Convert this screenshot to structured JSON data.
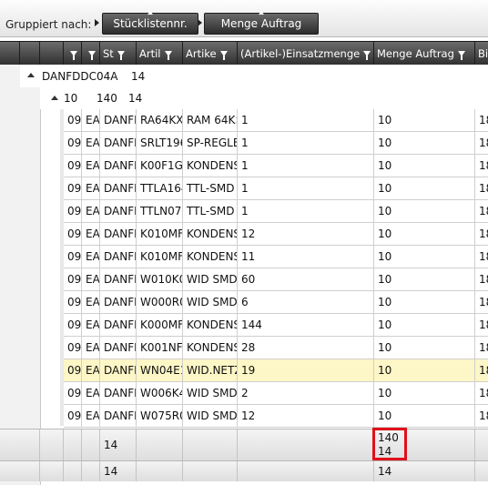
{
  "group_panel": {
    "label": "Gruppiert nach:",
    "chips": [
      "Stücklistennr.",
      "Menge Auftrag"
    ]
  },
  "columns": [
    "",
    "",
    "St",
    "Artil",
    "Artike",
    "(Artikel-)Einsatzmenge",
    "Menge Auftrag",
    "Bi"
  ],
  "group_level1": {
    "name": "DANFDDC04A",
    "count": "14"
  },
  "group_level2": {
    "value1": "10",
    "value2": "140",
    "count": "14"
  },
  "rows": [
    {
      "c1": "09",
      "c2": "EA",
      "c3": "DANFI",
      "c4": "RA64KX:",
      "c5": "RAM 64K>",
      "c6": "1",
      "c7": "10",
      "c8": "18"
    },
    {
      "c1": "09",
      "c2": "EA",
      "c3": "DANFI",
      "c4": "SRLT196",
      "c5": "SP-REGLEI",
      "c6": "1",
      "c7": "10",
      "c8": "18"
    },
    {
      "c1": "09",
      "c2": "EA",
      "c3": "DANFI",
      "c4": "K00F1G(",
      "c5": "KONDENS",
      "c6": "1",
      "c7": "10",
      "c8": "18"
    },
    {
      "c1": "09",
      "c2": "EA",
      "c3": "DANFI",
      "c4": "TTLA164",
      "c5": "TTL-SMD",
      "c6": "1",
      "c7": "10",
      "c8": "18"
    },
    {
      "c1": "09",
      "c2": "EA",
      "c3": "DANFI",
      "c4": "TTLN07S",
      "c5": "TTL-SMD",
      "c6": "1",
      "c7": "10",
      "c8": "18"
    },
    {
      "c1": "09",
      "c2": "EA",
      "c3": "DANFI",
      "c4": "K010MF",
      "c5": "KONDENS",
      "c6": "12",
      "c7": "10",
      "c8": "18"
    },
    {
      "c1": "09",
      "c2": "EA",
      "c3": "DANFI",
      "c4": "K010MF",
      "c5": "KONDENS",
      "c6": "11",
      "c7": "10",
      "c8": "18"
    },
    {
      "c1": "09",
      "c2": "EA",
      "c3": "DANFI",
      "c4": "W010K0",
      "c5": "WID SMD",
      "c6": "60",
      "c7": "10",
      "c8": "18"
    },
    {
      "c1": "09",
      "c2": "EA",
      "c3": "DANFI",
      "c4": "W000R0",
      "c5": "WID SMD",
      "c6": "6",
      "c7": "10",
      "c8": "18"
    },
    {
      "c1": "09",
      "c2": "EA",
      "c3": "DANFI",
      "c4": "K000MF",
      "c5": "KONDENS",
      "c6": "144",
      "c7": "10",
      "c8": "18"
    },
    {
      "c1": "09",
      "c2": "EA",
      "c3": "DANFI",
      "c4": "K001NF(",
      "c5": "KONDENS",
      "c6": "28",
      "c7": "10",
      "c8": "18"
    },
    {
      "c1": "09",
      "c2": "EA",
      "c3": "DANFI",
      "c4": "WN04E1",
      "c5": "WID.NETZ",
      "c6": "19",
      "c7": "10",
      "c8": "18",
      "selected": true
    },
    {
      "c1": "09",
      "c2": "EA",
      "c3": "DANFI",
      "c4": "W006K4",
      "c5": "WID SMD",
      "c6": "2",
      "c7": "10",
      "c8": "18"
    },
    {
      "c1": "09",
      "c2": "EA",
      "c3": "DANFI",
      "c4": "W075R0",
      "c5": "WID SMD",
      "c6": "12",
      "c7": "10",
      "c8": "18"
    }
  ],
  "footer_group2": {
    "count": "14",
    "menge_sum": "140",
    "menge_count": "14"
  },
  "footer_group1": {
    "count": "14",
    "menge_count": "14"
  }
}
